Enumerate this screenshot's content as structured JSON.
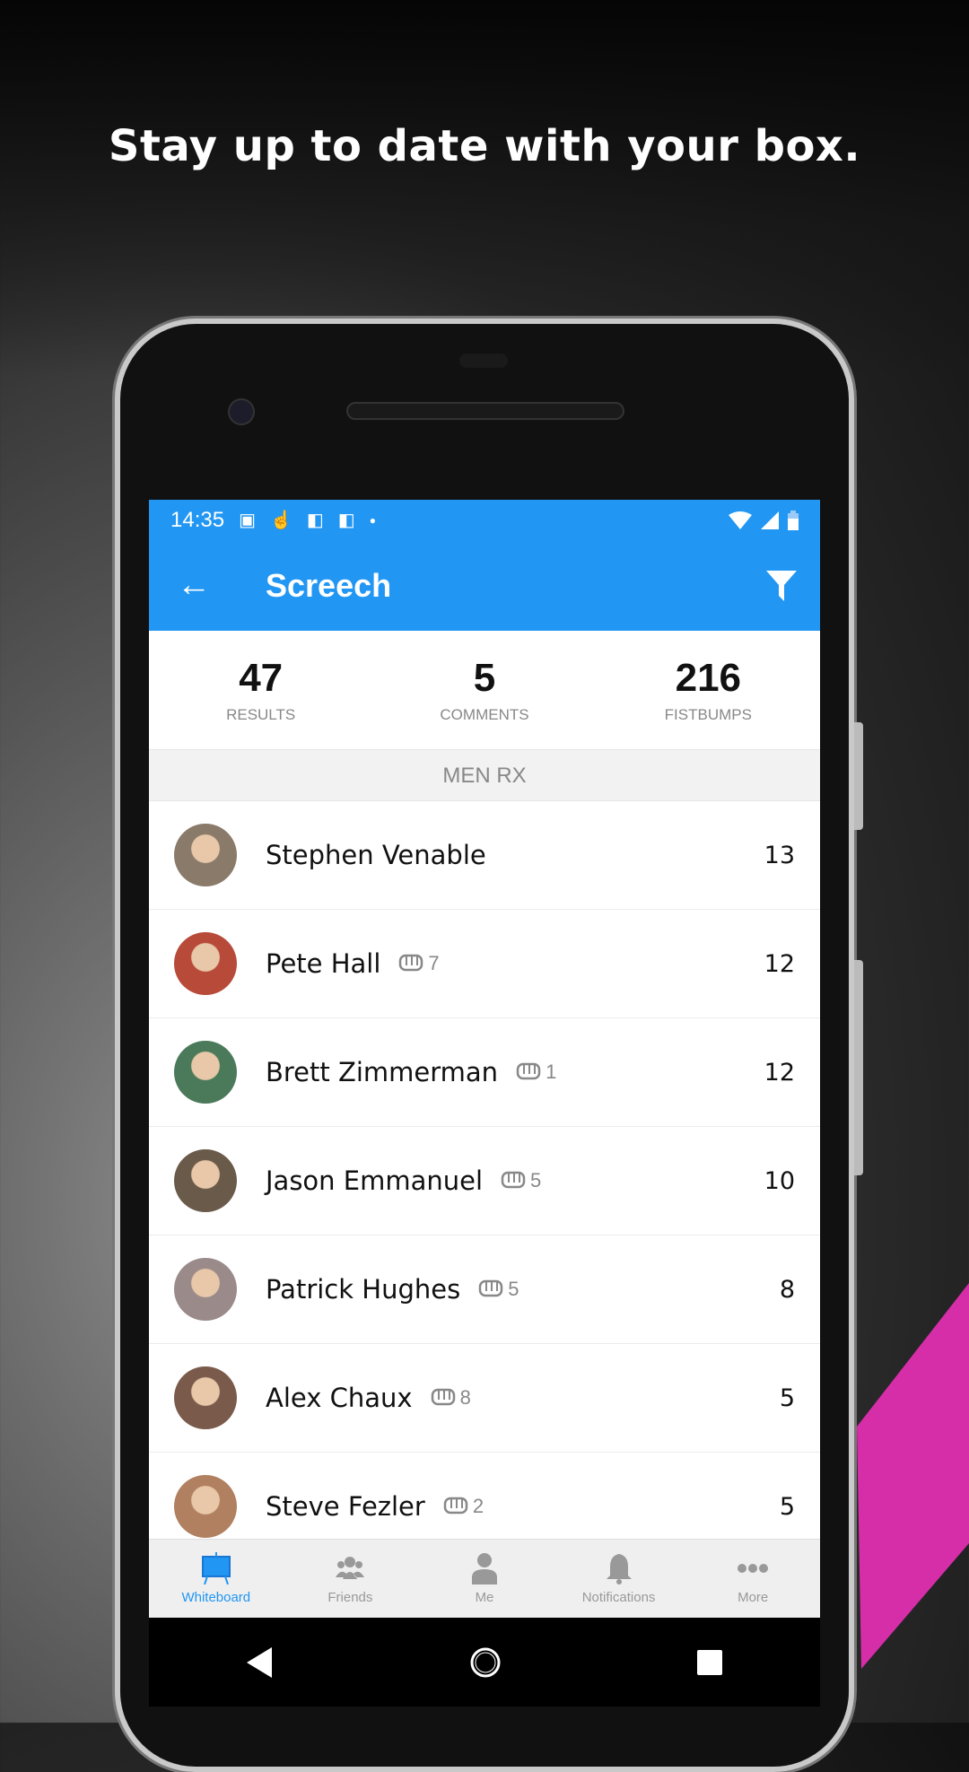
{
  "promo_title": "Stay up to date with your box.",
  "status_bar": {
    "time": "14:35"
  },
  "app_bar": {
    "title": "Screech",
    "back_icon": "arrow-left-icon",
    "filter_icon": "filter-icon"
  },
  "stats": [
    {
      "value": "47",
      "label": "RESULTS"
    },
    {
      "value": "5",
      "label": "COMMENTS"
    },
    {
      "value": "216",
      "label": "FISTBUMPS"
    }
  ],
  "section": "MEN RX",
  "athletes": [
    {
      "name": "Stephen Venable",
      "fistbumps": "",
      "score": "13",
      "avatar_color": "#8a7a6a"
    },
    {
      "name": "Pete Hall",
      "fistbumps": "7",
      "score": "12",
      "avatar_color": "#b84a3a"
    },
    {
      "name": "Brett Zimmerman",
      "fistbumps": "1",
      "score": "12",
      "avatar_color": "#4a7a5a"
    },
    {
      "name": "Jason Emmanuel",
      "fistbumps": "5",
      "score": "10",
      "avatar_color": "#6a5a4a"
    },
    {
      "name": "Patrick Hughes",
      "fistbumps": "5",
      "score": "8",
      "avatar_color": "#9a8a8a"
    },
    {
      "name": "Alex Chaux",
      "fistbumps": "8",
      "score": "5",
      "avatar_color": "#7a5a4a"
    },
    {
      "name": "Steve Fezler",
      "fistbumps": "2",
      "score": "5",
      "avatar_color": "#b08060"
    }
  ],
  "bottom_nav": [
    {
      "label": "Whiteboard",
      "icon": "whiteboard-icon",
      "active": true
    },
    {
      "label": "Friends",
      "icon": "friends-icon"
    },
    {
      "label": "Me",
      "icon": "person-icon"
    },
    {
      "label": "Notifications",
      "icon": "bell-icon"
    },
    {
      "label": "More",
      "icon": "more-icon"
    }
  ],
  "colors": {
    "primary": "#2196f3",
    "accent_pink": "#d62ea8"
  }
}
